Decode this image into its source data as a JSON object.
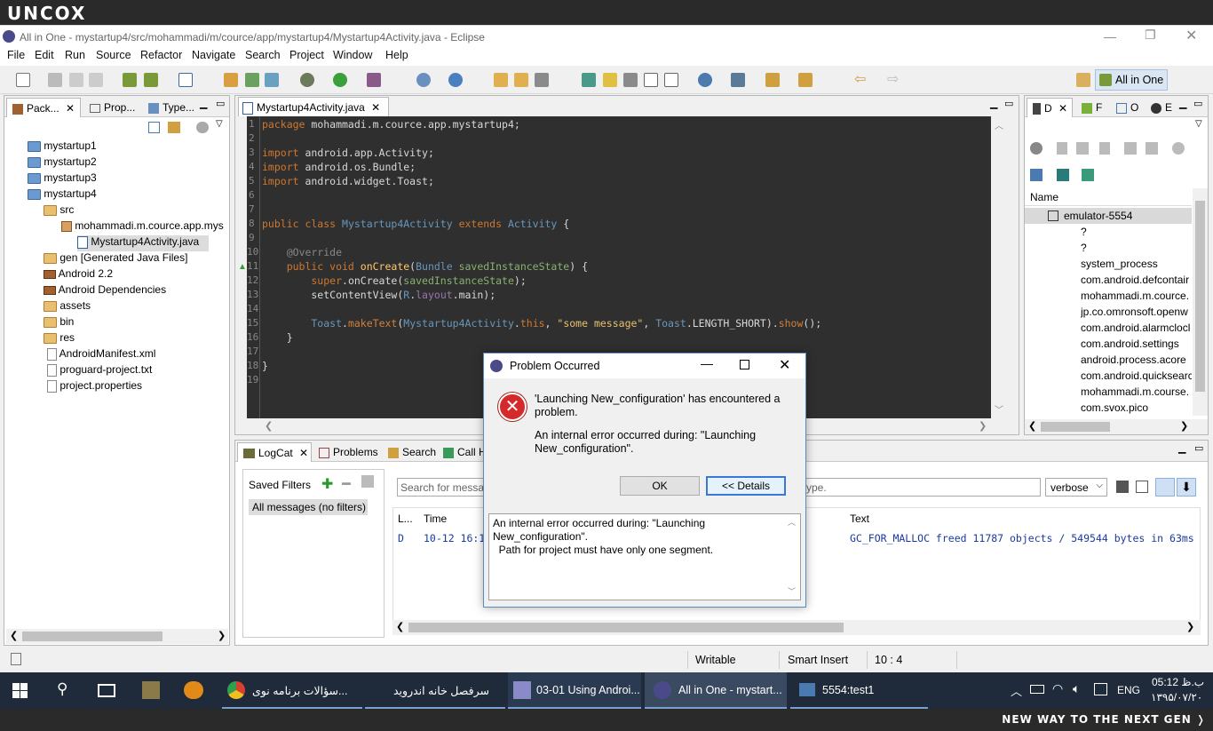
{
  "banner": {
    "logo": "UNCOX",
    "footer": "NEW WAY TO THE NEXT GEN ❭"
  },
  "window": {
    "title": "All in One - mystartup4/src/mohammadi/m/cource/app/mystartup4/Mystartup4Activity.java - Eclipse"
  },
  "menu": [
    "File",
    "Edit",
    "Run",
    "Source",
    "Refactor",
    "Navigate",
    "Search",
    "Project",
    "Window",
    "Help"
  ],
  "perspective": {
    "label": "All in One"
  },
  "left_panel": {
    "tabs": [
      "Pack...",
      "Prop...",
      "Type..."
    ],
    "tree": [
      "mystartup1",
      "mystartup2",
      "mystartup3",
      "mystartup4",
      "src",
      "mohammadi.m.cource.app.mys",
      "Mystartup4Activity.java",
      "gen [Generated Java Files]",
      "Android 2.2",
      "Android Dependencies",
      "assets",
      "bin",
      "res",
      "AndroidManifest.xml",
      "proguard-project.txt",
      "project.properties"
    ]
  },
  "editor": {
    "tab": "Mystartup4Activity.java",
    "line_numbers": [
      "1",
      "2",
      "3",
      "4",
      "5",
      "6",
      "7",
      "8",
      "9",
      "10",
      "11",
      "12",
      "13",
      "14",
      "15",
      "16",
      "17",
      "18",
      "19"
    ],
    "code": {
      "l1_kw": "package",
      "l1_rest": " mohammadi.m.cource.app.mystartup4;",
      "l3_kw": "import",
      "l3_rest": " android.app.Activity;",
      "l4_kw": "import",
      "l4_rest": " android.os.Bundle;",
      "l5_kw": "import",
      "l5_rest": " android.widget.Toast;",
      "l8_a": "public class ",
      "l8_b": "Mystartup4Activity",
      "l8_c": " extends ",
      "l8_d": "Activity",
      "l8_e": " {",
      "l10": "    @Override",
      "l11_a": "    public void ",
      "l11_b": "onCreate",
      "l11_c": "(",
      "l11_d": "Bundle",
      "l11_e": " savedInstanceState",
      "l11_f": ") {",
      "l12_a": "        super",
      "l12_b": ".onCreate(",
      "l12_c": "savedInstanceState",
      "l12_d": ");",
      "l13_a": "        setContentView(",
      "l13_b": "R",
      "l13_c": ".",
      "l13_d": "layout",
      "l13_e": ".main);",
      "l15_a": "        Toast",
      "l15_b": ".",
      "l15_c": "makeText",
      "l15_d": "(",
      "l15_e": "Mystartup4Activity",
      "l15_f": ".",
      "l15_g": "this",
      "l15_h": ", ",
      "l15_i": "\"some message\"",
      "l15_j": ", ",
      "l15_k": "Toast",
      "l15_l": ".LENGTH_SHORT).",
      "l15_m": "show",
      "l15_n": "();",
      "l16": "    }",
      "l18": "}"
    }
  },
  "right_panel": {
    "tabs": [
      "D",
      "F",
      "O",
      "E"
    ],
    "column": "Name",
    "device": "emulator-5554",
    "processes": [
      "?",
      "?",
      "system_process",
      "com.android.defcontair",
      "mohammadi.m.cource.",
      "jp.co.omronsoft.openw",
      "com.android.alarmclocl",
      "com.android.settings",
      "android.process.acore",
      "com.android.quicksearc",
      "mohammadi.m.course.",
      "com.svox.pico"
    ]
  },
  "bottom_panel": {
    "tabs": [
      "LogCat",
      "Problems",
      "Search",
      "Call H"
    ],
    "saved_filters": "Saved Filters",
    "all_messages": "All messages (no filters)",
    "search_placeholder": "Search for messag",
    "filter_tail": "ype.",
    "level": "verbose",
    "columns": {
      "level": "L...",
      "time": "Time",
      "text": "Text"
    },
    "row": {
      "level": "D",
      "time": "10-12 16:1",
      "text": "GC_FOR_MALLOC freed 11787 objects / 549544 bytes in 63ms"
    }
  },
  "status": {
    "writable": "Writable",
    "insert": "Smart Insert",
    "position": "10 : 4"
  },
  "dialog": {
    "title": "Problem Occurred",
    "message": "'Launching New_configuration' has encountered a problem.",
    "detail": "An internal error occurred during: \"Launching New_configuration\".",
    "ok": "OK",
    "details_btn": "<< Details",
    "details_text_1": "An internal error occurred during: \"Launching",
    "details_text_2": "New_configuration\".",
    "details_text_3": "  Path for project must have only one segment."
  },
  "taskbar": {
    "items": [
      "سؤالات برنامه نوی...",
      "سرفصل خانه اندروید",
      "03-01 Using Androi...",
      "All in One - mystart...",
      "5554:test1"
    ],
    "lang": "ENG",
    "time": "05:12 ب.ظ",
    "date": "۱۳۹۵/۰۷/۲۰"
  },
  "colors": {
    "accent": "#5a8ac6",
    "error": "#d42a2a",
    "editor_bg": "#2f2f2f",
    "taskbar": "#1f2a3a"
  }
}
